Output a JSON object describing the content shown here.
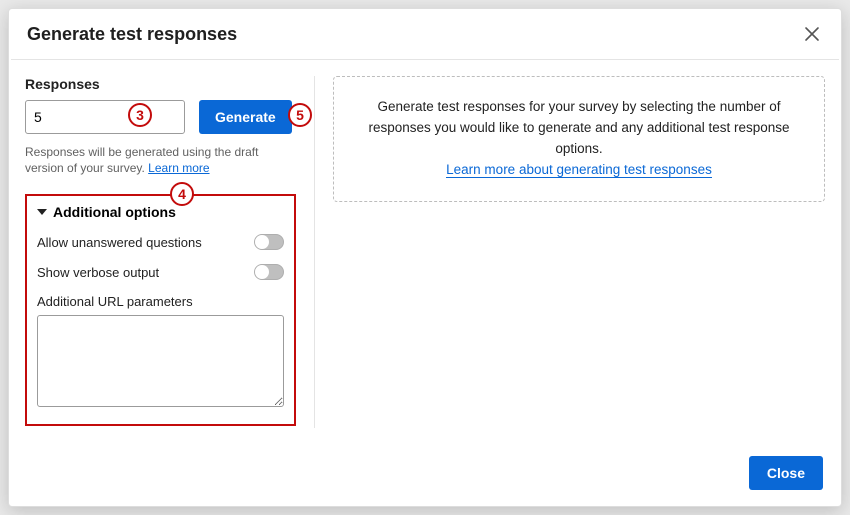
{
  "title": "Generate test responses",
  "left": {
    "responses_label": "Responses",
    "responses_value": "5",
    "generate_button": "Generate",
    "hint_text": "Responses will be generated using the draft version of your survey. ",
    "hint_link": "Learn more"
  },
  "right_info": {
    "line": "Generate test responses for your survey by selecting the number of responses you would like to generate and any additional test response options.",
    "link": "Learn more about generating test responses"
  },
  "options": {
    "header": "Additional options",
    "allow_unanswered_label": "Allow unanswered questions",
    "allow_unanswered_value": false,
    "verbose_label": "Show verbose output",
    "verbose_value": false,
    "url_params_label": "Additional URL parameters",
    "url_params_value": ""
  },
  "footer": {
    "close": "Close"
  },
  "callouts": {
    "c3": "3",
    "c4": "4",
    "c5": "5"
  }
}
